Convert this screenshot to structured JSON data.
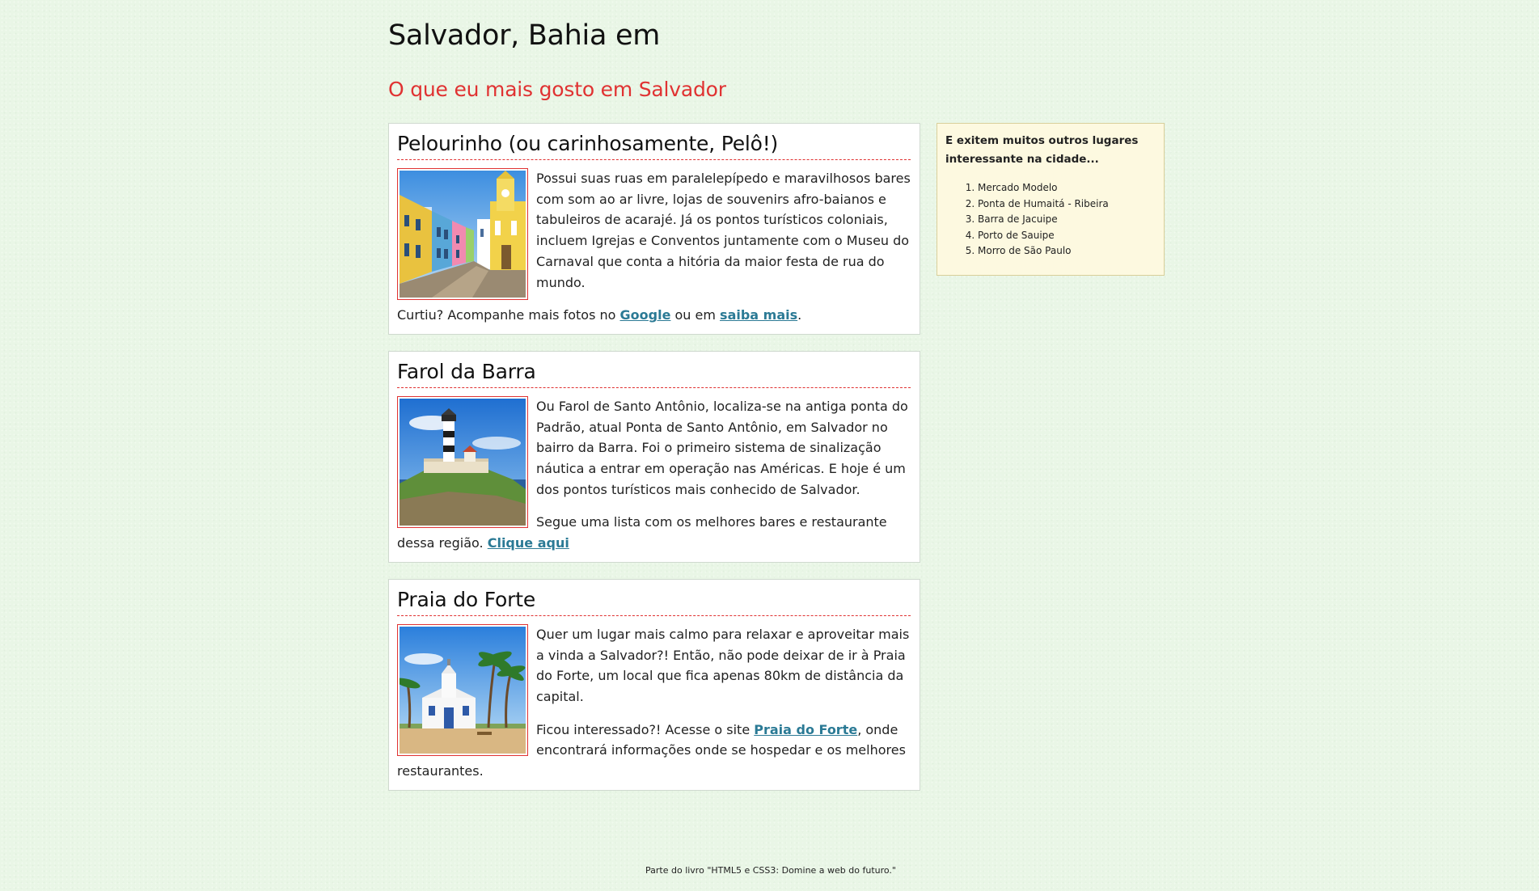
{
  "header": {
    "title": "Salvador, Bahia em",
    "subtitle": "O que eu mais gosto em Salvador"
  },
  "articles": [
    {
      "title": "Pelourinho (ou carinhosamente, Pelô!)",
      "image_icon": "colonial-street-photo",
      "paragraph1": "Possui suas ruas em paralelepípedo e maravilhosos bares com som ao ar livre, lojas de souvenirs afro-baianos e tabuleiros de acarajé. Já os pontos turísticos coloniais, incluem Igrejas e Conventos juntamente com o Museu do Carnaval que conta a hitória da maior festa de rua do mundo.",
      "p2_before": "Curtiu? Acompanhe mais fotos no ",
      "link1": "Google",
      "p2_middle": " ou em ",
      "link2": "saiba mais",
      "p2_after": "."
    },
    {
      "title": "Farol da Barra",
      "image_icon": "lighthouse-photo",
      "paragraph1": "Ou Farol de Santo Antônio, localiza-se na antiga ponta do Padrão, atual Ponta de Santo Antônio, em Salvador no bairro da Barra. Foi o primeiro sistema de sinalização náutica a entrar em operação nas Américas. E hoje é um dos pontos turísticos mais conhecido de Salvador.",
      "p2_before": "Segue uma lista com os melhores bares e restaurante dessa região. ",
      "link1": "Clique aqui"
    },
    {
      "title": "Praia do Forte",
      "image_icon": "beach-chapel-photo",
      "paragraph1": "Quer um lugar mais calmo para relaxar e aproveitar mais a vinda a Salvador?! Então, não pode deixar de ir à Praia do Forte, um local que fica apenas 80km de distância da capital.",
      "p2_before": "Ficou interessado?! Acesse o site ",
      "link1": "Praia do Forte",
      "p2_after": ", onde encontrará informações onde se hospedar e os melhores restaurantes."
    }
  ],
  "sidebar": {
    "title": "E exitem muitos outros lugares interessante na cidade...",
    "items": [
      "Mercado Modelo",
      "Ponta de Humaitá - Ribeira",
      "Barra de Jacuipe",
      "Porto de Sauipe",
      "Morro de São Paulo"
    ]
  },
  "footer": {
    "note": "Parte do livro \"HTML5 e CSS3: Domine a web do futuro.\""
  },
  "colors": {
    "background": "#e9f6e6",
    "accent_red": "#e03232",
    "link": "#2b7a95",
    "sidebar_bg": "#fdf9e0"
  }
}
